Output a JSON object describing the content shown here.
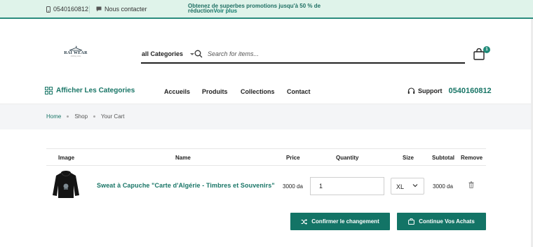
{
  "topbar": {
    "phone": "0540160812",
    "contact_label": "Nous contacter",
    "promo_text": "Obtenez de superbes promotions jusqu'à 50 % de réduction",
    "promo_link": "Voir plus"
  },
  "logo": {
    "brand": "RAI WEAR",
    "tagline": "clothing store"
  },
  "search": {
    "category_label": "all Categories",
    "placeholder": "Search for items...",
    "value": ""
  },
  "cart": {
    "count": "1"
  },
  "nav": {
    "categories_label": "Afficher Les Categories",
    "links": [
      "Accueils",
      "Produits",
      "Collections",
      "Contact"
    ],
    "support_label": "Support",
    "support_phone": "0540160812"
  },
  "breadcrumb": [
    "Home",
    "Shop",
    "Your Cart"
  ],
  "table": {
    "headers": [
      "Image",
      "Name",
      "Price",
      "Quantity",
      "Size",
      "Subtotal",
      "Remove"
    ],
    "rows": [
      {
        "name": "Sweat à Capuche \"Carte d'Algérie - Timbres et Souvenirs\"",
        "price": "3000 da",
        "quantity": "1",
        "size": "XL",
        "subtotal": "3000 da"
      }
    ]
  },
  "actions": {
    "confirm_label": "Confirmer le changement",
    "continue_label": "Continue Vos Achats"
  },
  "colors": {
    "accent": "#137466",
    "promo_bg": "#dff3ea",
    "crumb_bg": "#f4f5f7"
  }
}
